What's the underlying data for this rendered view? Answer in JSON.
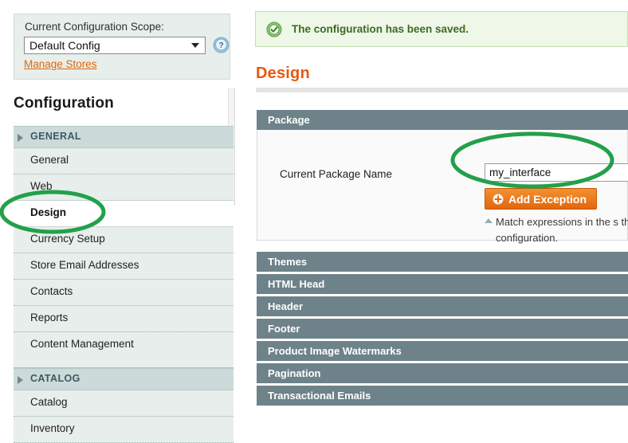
{
  "scope": {
    "label": "Current Configuration Scope:",
    "selected": "Default Config",
    "options": [
      "Default Config"
    ],
    "manage_stores_link": "Manage Stores",
    "help_icon": "help-circle-icon",
    "caret_icon": "chevron-down-icon"
  },
  "nav": {
    "title": "Configuration",
    "groups": [
      {
        "label": "GENERAL",
        "items": [
          {
            "label": "General",
            "active": false
          },
          {
            "label": "Web",
            "active": false
          },
          {
            "label": "Design",
            "active": true
          },
          {
            "label": "Currency Setup",
            "active": false
          },
          {
            "label": "Store Email Addresses",
            "active": false
          },
          {
            "label": "Contacts",
            "active": false
          },
          {
            "label": "Reports",
            "active": false
          },
          {
            "label": "Content Management",
            "active": false
          }
        ]
      },
      {
        "label": "CATALOG",
        "items": [
          {
            "label": "Catalog",
            "active": false
          },
          {
            "label": "Inventory",
            "active": false
          }
        ]
      }
    ]
  },
  "notice": {
    "icon": "success-check-icon",
    "text": "The configuration has been saved."
  },
  "page": {
    "title": "Design"
  },
  "package_section": {
    "header": "Package",
    "field_label": "Current Package Name",
    "field_value": "my_interface",
    "add_exception_label": "Add Exception",
    "add_exception_icon": "plus-circle-icon",
    "note_icon": "triangle-up-icon",
    "note_text": "Match expressions in the s the configuration."
  },
  "sections": [
    {
      "label": "Themes"
    },
    {
      "label": "HTML Head"
    },
    {
      "label": "Header"
    },
    {
      "label": "Footer"
    },
    {
      "label": "Product Image Watermarks"
    },
    {
      "label": "Pagination"
    },
    {
      "label": "Transactional Emails"
    }
  ],
  "annotations": {
    "color": "#22a04a",
    "shapes": [
      {
        "name": "design-nav-highlight"
      },
      {
        "name": "package-field-highlight"
      }
    ]
  },
  "colors": {
    "accent_orange": "#ea580c",
    "panel_header": "#6d8289",
    "nav_bg": "#e7eeec",
    "nav_group_bg": "#ccdada",
    "success_bg": "#eef7e8",
    "success_text": "#3d6b22",
    "annotation_green": "#22a04a"
  }
}
